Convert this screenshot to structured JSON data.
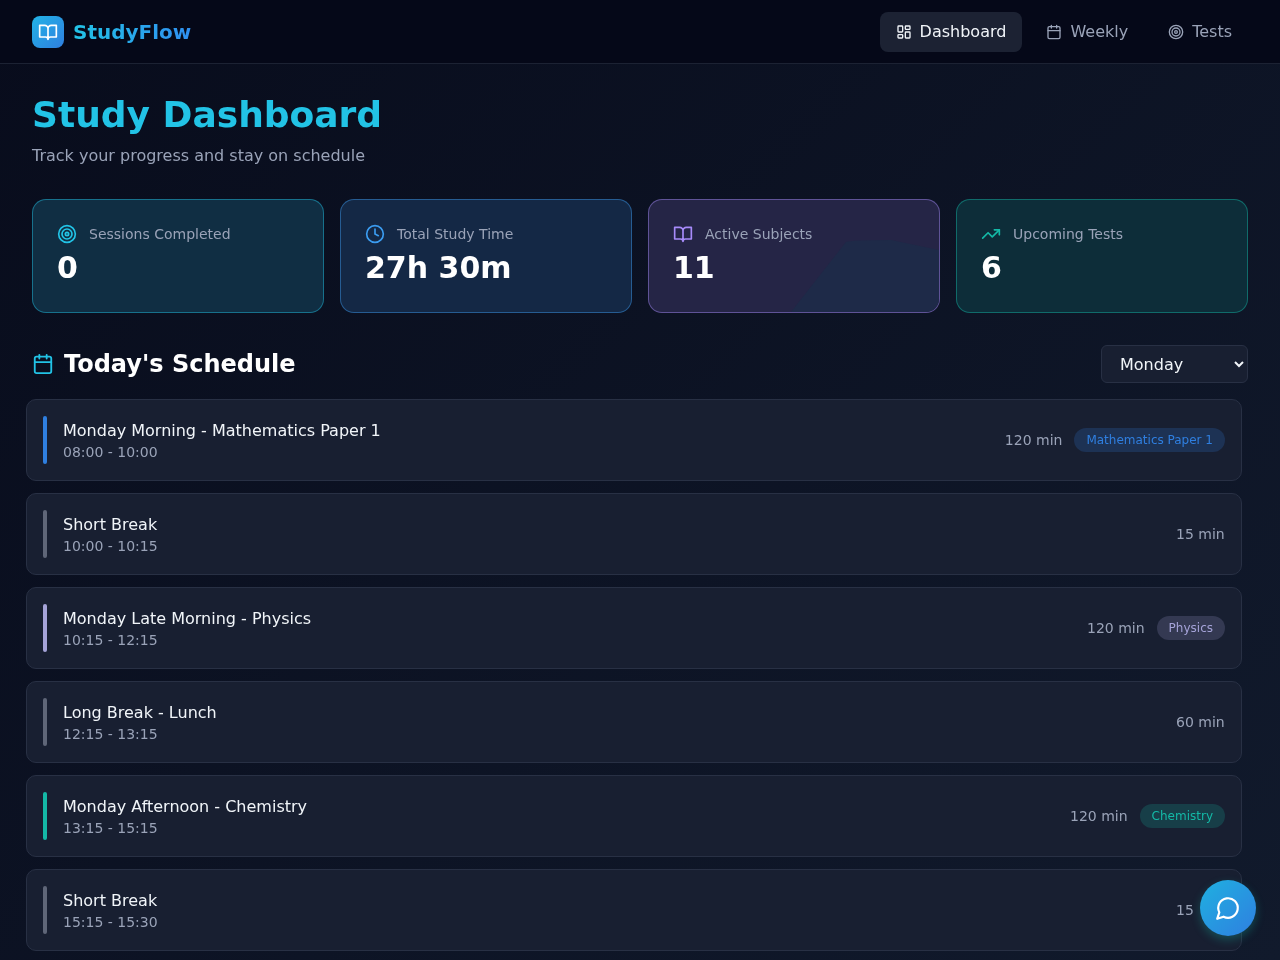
{
  "brand": {
    "name": "StudyFlow"
  },
  "nav": [
    {
      "label": "Dashboard",
      "selected": true
    },
    {
      "label": "Weekly",
      "selected": false
    },
    {
      "label": "Tests",
      "selected": false
    }
  ],
  "page": {
    "title": "Study Dashboard",
    "subtitle": "Track your progress and stay on schedule"
  },
  "stats": [
    {
      "label": "Sessions Completed",
      "value": "0",
      "color": "#22c3e6"
    },
    {
      "label": "Total Study Time",
      "value": "27h 30m",
      "color": "#3b9cf0"
    },
    {
      "label": "Active Subjects",
      "value": "11",
      "color": "#a78bfa"
    },
    {
      "label": "Upcoming Tests",
      "value": "6",
      "color": "#14b8a6"
    }
  ],
  "schedule": {
    "title": "Today's Schedule",
    "day": "Monday",
    "rows": [
      {
        "title": "Monday Morning - Mathematics Paper 1",
        "time": "08:00 - 10:00",
        "duration": "120 min",
        "color": "#2f7fe0",
        "tag": "Mathematics Paper 1"
      },
      {
        "title": "Short Break",
        "time": "10:00 - 10:15",
        "duration": "15 min",
        "color": "#5f6678"
      },
      {
        "title": "Monday Late Morning - Physics",
        "time": "10:15 - 12:15",
        "duration": "120 min",
        "color": "#a5a3d8",
        "tag": "Physics"
      },
      {
        "title": "Long Break - Lunch",
        "time": "12:15 - 13:15",
        "duration": "60 min",
        "color": "#5f6678"
      },
      {
        "title": "Monday Afternoon - Chemistry",
        "time": "13:15 - 15:15",
        "duration": "120 min",
        "color": "#14b8a6",
        "tag": "Chemistry"
      },
      {
        "title": "Short Break",
        "time": "15:15 - 15:30",
        "duration": "15",
        "color": "#5f6678"
      }
    ]
  }
}
